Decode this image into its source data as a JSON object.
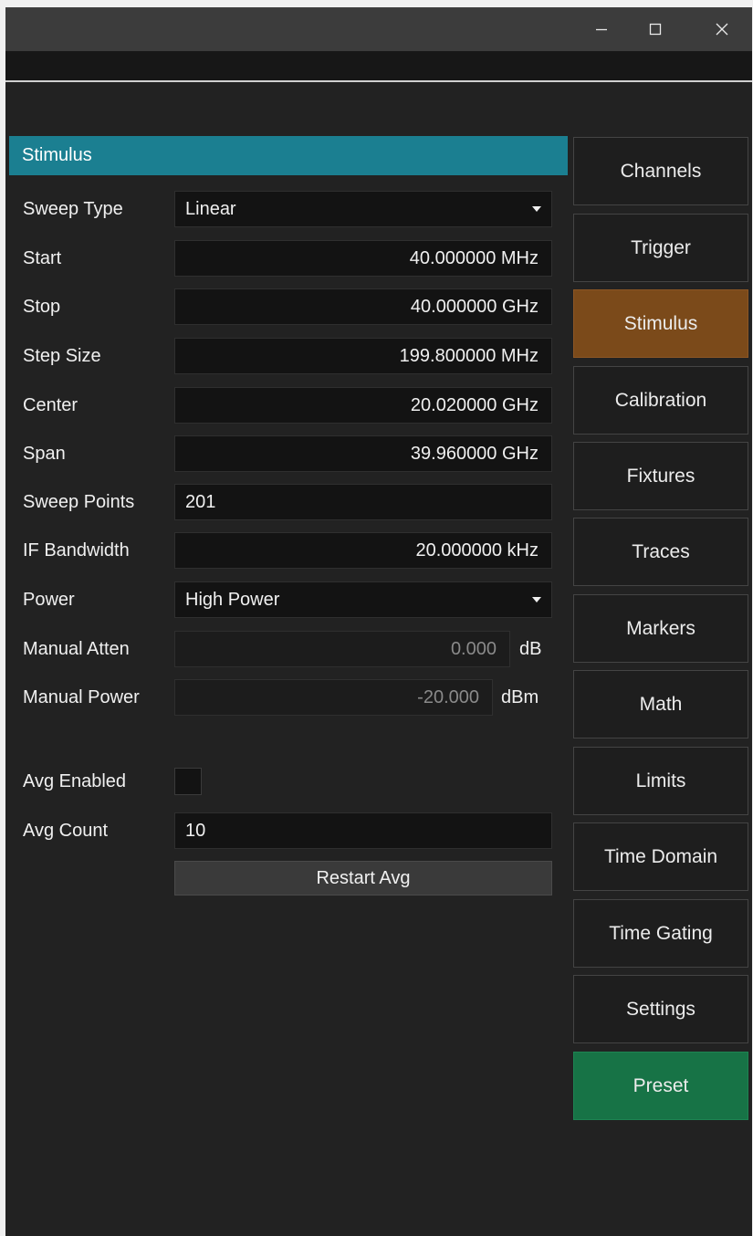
{
  "window_controls": {
    "minimize_icon": "minimize-icon",
    "maximize_icon": "maximize-icon",
    "close_icon": "close-icon"
  },
  "panel": {
    "header": "Stimulus",
    "sweep_type": {
      "label": "Sweep Type",
      "value": "Linear"
    },
    "start": {
      "label": "Start",
      "value": "40.000000 MHz"
    },
    "stop": {
      "label": "Stop",
      "value": "40.000000 GHz"
    },
    "step_size": {
      "label": "Step Size",
      "value": "199.800000 MHz"
    },
    "center": {
      "label": "Center",
      "value": "20.020000 GHz"
    },
    "span": {
      "label": "Span",
      "value": "39.960000 GHz"
    },
    "sweep_points": {
      "label": "Sweep Points",
      "value": "201"
    },
    "if_bandwidth": {
      "label": "IF Bandwidth",
      "value": "20.000000 kHz"
    },
    "power": {
      "label": "Power",
      "value": "High Power"
    },
    "manual_atten": {
      "label": "Manual Atten",
      "value": "0.000",
      "unit": "dB"
    },
    "manual_power": {
      "label": "Manual Power",
      "value": "-20.000",
      "unit": "dBm"
    },
    "avg_enabled": {
      "label": "Avg Enabled",
      "checked": false
    },
    "avg_count": {
      "label": "Avg Count",
      "value": "10"
    },
    "restart_avg": "Restart Avg"
  },
  "nav": {
    "items": [
      {
        "label": "Channels"
      },
      {
        "label": "Trigger"
      },
      {
        "label": "Stimulus",
        "active": true
      },
      {
        "label": "Calibration"
      },
      {
        "label": "Fixtures"
      },
      {
        "label": "Traces"
      },
      {
        "label": "Markers"
      },
      {
        "label": "Math"
      },
      {
        "label": "Limits"
      },
      {
        "label": "Time Domain"
      },
      {
        "label": "Time Gating"
      },
      {
        "label": "Settings"
      },
      {
        "label": "Preset"
      }
    ]
  },
  "colors": {
    "header": "#1b7f91",
    "active_nav": "#7b4a1a",
    "preset": "#177346",
    "background": "#222222"
  }
}
